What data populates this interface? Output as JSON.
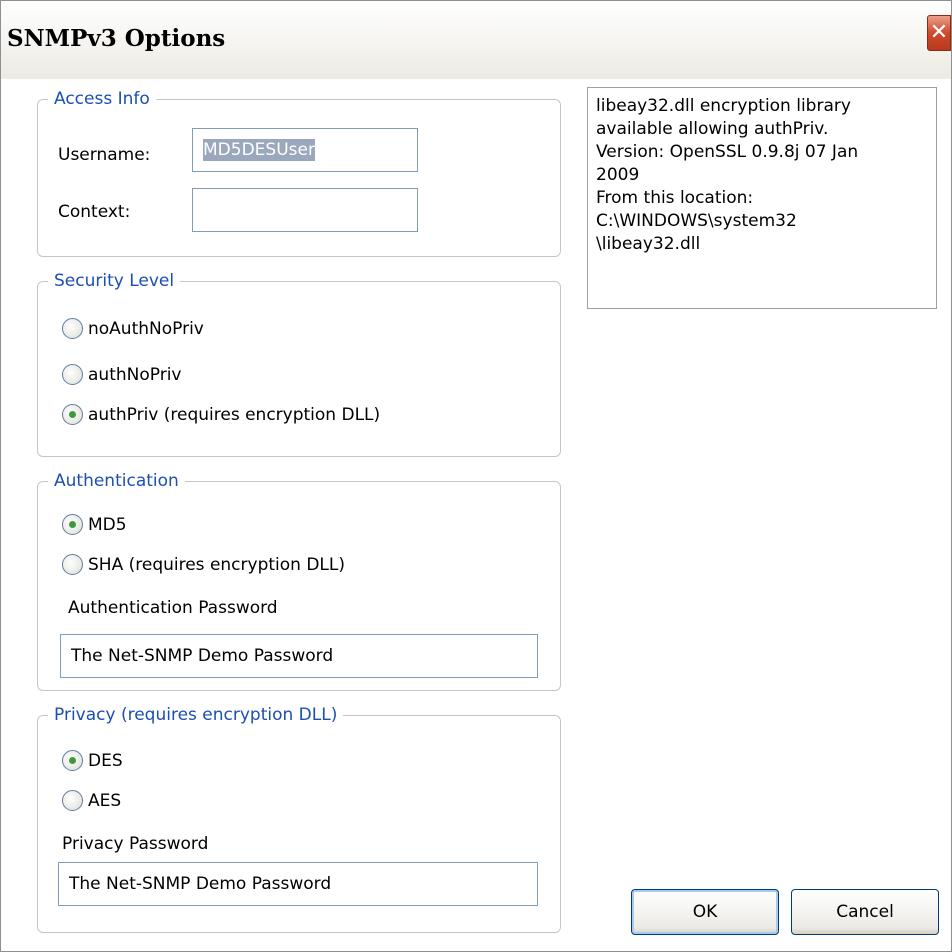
{
  "window": {
    "title": "SNMPv3 Options",
    "close_glyph": "✕"
  },
  "access_info": {
    "legend": "Access Info",
    "username_label": "Username:",
    "username_value": "MD5DESUser",
    "context_label": "Context:",
    "context_value": ""
  },
  "security_level": {
    "legend": "Security Level",
    "options": [
      {
        "label": "noAuthNoPriv",
        "checked": false
      },
      {
        "label": "authNoPriv",
        "checked": false
      },
      {
        "label": "authPriv (requires encryption DLL)",
        "checked": true
      }
    ]
  },
  "authentication": {
    "legend": "Authentication",
    "options": [
      {
        "label": "MD5",
        "checked": true
      },
      {
        "label": "SHA (requires encryption DLL)",
        "checked": false
      }
    ],
    "password_label": "Authentication Password",
    "password_value": "The Net-SNMP Demo Password"
  },
  "privacy": {
    "legend": "Privacy (requires encryption DLL)",
    "options": [
      {
        "label": "DES",
        "checked": true
      },
      {
        "label": "AES",
        "checked": false
      }
    ],
    "password_label": "Privacy Password",
    "password_value": "The Net-SNMP Demo Password"
  },
  "info": {
    "lines": [
      "libeay32.dll encryption library",
      "available allowing authPriv.",
      "Version: OpenSSL 0.9.8j 07 Jan",
      "2009",
      "From this location:",
      "C:\\WINDOWS\\system32",
      "\\libeay32.dll"
    ]
  },
  "buttons": {
    "ok": "OK",
    "cancel": "Cancel"
  }
}
